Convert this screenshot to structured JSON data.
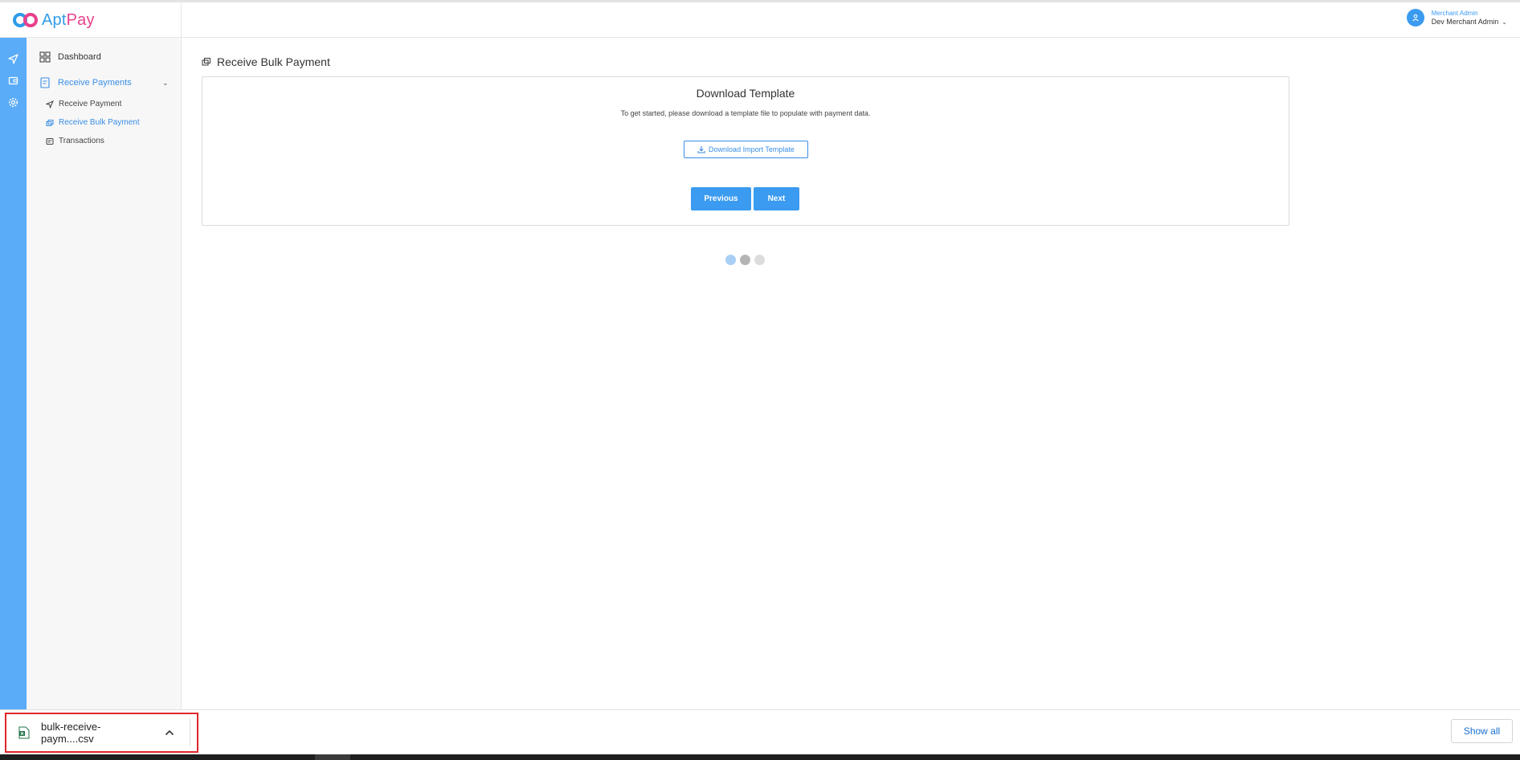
{
  "brand": {
    "name_part1": "Apt",
    "name_part2": "Pay",
    "primary": "#2f9be8",
    "accent": "#e8418c"
  },
  "user": {
    "role": "Merchant Admin",
    "name": "Dev Merchant Admin"
  },
  "rail": {
    "icons": [
      "send-icon",
      "wallet-icon",
      "settings-gear-icon"
    ],
    "color": "#5aabf8"
  },
  "sidebar": {
    "dashboard": "Dashboard",
    "receive_payments": "Receive Payments",
    "sub_items": [
      "Receive Payment",
      "Receive Bulk Payment",
      "Transactions"
    ],
    "active_item": "Receive Bulk Payment"
  },
  "page": {
    "title": "Receive Bulk Payment",
    "card_title": "Download Template",
    "card_desc": "To get started, please download a template file to populate with payment data.",
    "download_button": "Download Import Template",
    "previous_button": "Previous",
    "next_button": "Next",
    "steps": {
      "total": 3,
      "current": 1
    }
  },
  "downloads": {
    "file_name": "bulk-receive-paym....csv",
    "show_all": "Show all"
  },
  "colors": {
    "button_blue": "#3a9bf0",
    "link_blue": "#3a8ee6",
    "highlight_red": "#e0262a"
  }
}
